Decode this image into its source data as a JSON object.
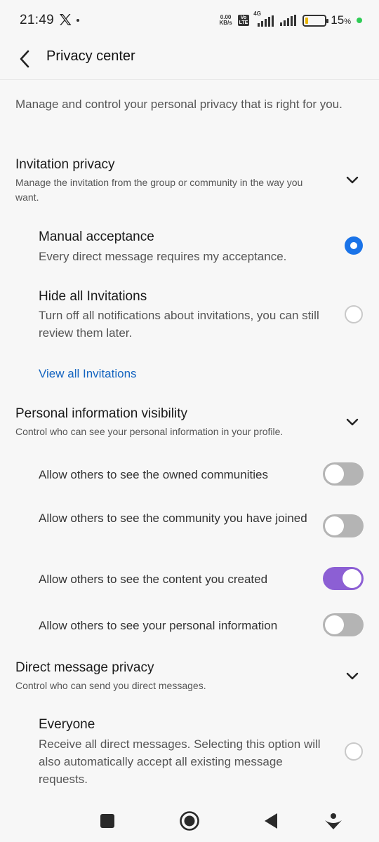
{
  "status_bar": {
    "time": "21:49",
    "net_speed_top": "0.00",
    "net_speed_bottom": "KB/s",
    "volte_top": "Vo",
    "volte_bottom": "LTE",
    "network": "4G",
    "battery_percent": "15",
    "battery_unit": "%",
    "icons": [
      "x-logo-icon",
      "signal-icon",
      "battery-icon"
    ]
  },
  "header": {
    "title": "Privacy center"
  },
  "intro": "Manage and control your personal privacy that is right for you.",
  "invitation": {
    "title": "Invitation privacy",
    "description": "Manage the invitation from the group or community in the way you want.",
    "options": [
      {
        "title": "Manual acceptance",
        "description": "Every direct message requires my acceptance.",
        "selected": true
      },
      {
        "title": "Hide all Invitations",
        "description": "Turn off all notifications about invitations, you can still review them later.",
        "selected": false
      }
    ],
    "link": "View all Invitations"
  },
  "visibility": {
    "title": "Personal information visibility",
    "description": "Control who can see your personal information in your profile.",
    "toggles": [
      {
        "label": "Allow others to see the owned communities",
        "on": false
      },
      {
        "label": "Allow others to see the community you have joined",
        "on": false
      },
      {
        "label": "Allow others to see the content you created",
        "on": true
      },
      {
        "label": "Allow others to see your personal information",
        "on": false
      }
    ]
  },
  "direct_message": {
    "title": "Direct message privacy",
    "description": "Control who can send you direct messages.",
    "options": [
      {
        "title": "Everyone",
        "description": "Receive all direct messages. Selecting this option will also automatically accept all existing message requests.",
        "selected": false
      }
    ]
  },
  "colors": {
    "radio_selected": "#1a73e8",
    "toggle_on": "#8c5fd4",
    "link": "#1565c0"
  }
}
